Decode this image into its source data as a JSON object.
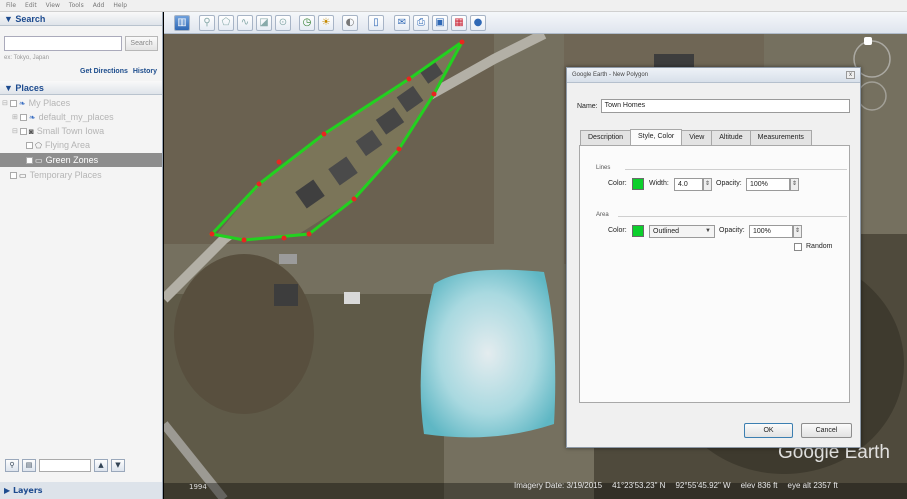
{
  "menu": [
    "File",
    "Edit",
    "View",
    "Tools",
    "Add",
    "Help"
  ],
  "search": {
    "header": "▼ Search",
    "placeholder": "",
    "button": "Search",
    "example": "ex: Tokyo, Japan",
    "get_directions": "Get Directions",
    "history": "History"
  },
  "places": {
    "header": "▼ Places",
    "items": [
      {
        "label": "My Places"
      },
      {
        "label": "default_my_places"
      },
      {
        "label": "Small Town Iowa"
      },
      {
        "label": "Flying Area"
      },
      {
        "label": "Green Zones"
      },
      {
        "label": "Temporary Places"
      }
    ]
  },
  "layers": {
    "header": "▶ Layers"
  },
  "toolbar": {
    "icons": [
      "sidebar-icon",
      "placemark-icon",
      "polygon-icon",
      "path-icon",
      "image-overlay-icon",
      "tour-icon",
      "historical-imagery-icon",
      "sun-icon",
      "planets-icon",
      "ruler-icon",
      "email-icon",
      "print-icon",
      "save-image-icon",
      "maps-icon",
      "earth-gallery-icon"
    ]
  },
  "map": {
    "imagery_date": "Imagery Date: 3/19/2015",
    "lat": "41°23'53.23\" N",
    "lon": "92°55'45.92\" W",
    "elev": "elev  836 ft",
    "eye_alt": "eye alt  2357 ft",
    "scale": "1994",
    "watermark": "Google Earth",
    "polygon_color": "#22d11f",
    "vertex_color": "#e8261f"
  },
  "dialog": {
    "title": "Google Earth - New Polygon",
    "close": "x",
    "name_label": "Name:",
    "name_value": "Town Homes",
    "tabs": [
      "Description",
      "Style, Color",
      "View",
      "Altitude",
      "Measurements"
    ],
    "lines": {
      "title": "Lines",
      "color_label": "Color:",
      "color": "#0ccf2c",
      "width_label": "Width:",
      "width_value": "4.0",
      "opacity_label": "Opacity:",
      "opacity_value": "100%"
    },
    "area": {
      "title": "Area",
      "color_label": "Color:",
      "color": "#0ccf2c",
      "fill_mode": "Outlined",
      "opacity_label": "Opacity:",
      "opacity_value": "100%",
      "random_label": "Random"
    },
    "ok": "OK",
    "cancel": "Cancel"
  }
}
